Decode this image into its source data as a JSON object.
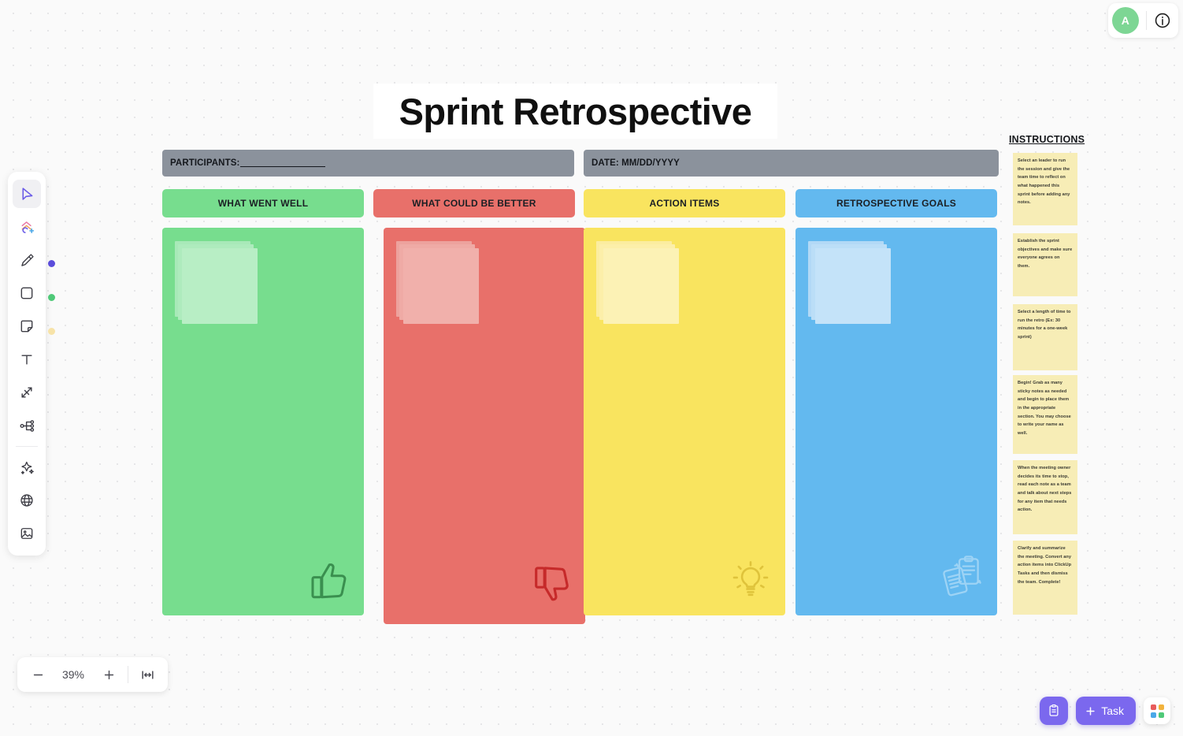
{
  "app": {
    "zoom_level": "39%",
    "avatar_initial": "A",
    "accent_color": "#7b68ee"
  },
  "toolbar": {
    "items": [
      {
        "name": "select-tool",
        "label": "Select",
        "active": true
      },
      {
        "name": "shapes-tool",
        "label": "Shapes",
        "active": false
      },
      {
        "name": "pen-tool",
        "label": "Pen",
        "active": false
      },
      {
        "name": "rectangle-tool",
        "label": "Rectangle",
        "active": false
      },
      {
        "name": "sticky-note-tool",
        "label": "Sticky Note",
        "active": false
      },
      {
        "name": "text-tool",
        "label": "Text",
        "active": false
      },
      {
        "name": "connector-tool",
        "label": "Connector",
        "active": false
      },
      {
        "name": "mindmap-tool",
        "label": "Mind Map",
        "active": false
      },
      {
        "name": "ai-tool",
        "label": "AI",
        "active": false
      },
      {
        "name": "web-tool",
        "label": "Embed",
        "active": false
      },
      {
        "name": "image-tool",
        "label": "Image",
        "active": false
      }
    ],
    "color_dots": [
      "#5b4ddb",
      "#4fc978",
      "#f7e3a8"
    ]
  },
  "zoom_controls": {
    "zoom_out_label": "−",
    "zoom_in_label": "+",
    "value": "39%",
    "fit_label": "|↔|"
  },
  "bottom_actions": {
    "doc_label": "",
    "task_label": "Task",
    "apps_label": ""
  },
  "board": {
    "title": "Sprint Retrospective",
    "participants_label": "PARTICIPANTS:",
    "date_label": "DATE: MM/DD/YYYY",
    "columns": [
      {
        "header": "WHAT WENT WELL",
        "header_color": "#77dd8e",
        "body_color": "#77dd8e",
        "note_color": "#b5eec2",
        "icon": "thumbs-up-icon",
        "icon_color": "#3a8f4f"
      },
      {
        "header": "WHAT COULD BE BETTER",
        "header_color": "#e8706a",
        "body_color": "#e8706a",
        "note_color": "#f0a5a0",
        "icon": "thumbs-down-icon",
        "icon_color": "#c62a2a"
      },
      {
        "header": "ACTION ITEMS",
        "header_color": "#f9e45f",
        "body_color": "#f9e45f",
        "note_color": "#fbf0ab",
        "icon": "lightbulb-icon",
        "icon_color": "#dfc33b"
      },
      {
        "header": "RETROSPECTIVE GOALS",
        "header_color": "#63b9ef",
        "body_color": "#63b9ef",
        "note_color": "#bddff7",
        "icon": "clipboard-checklist-icon",
        "icon_color": "#9dd3f5"
      }
    ]
  },
  "instructions": {
    "title": "INSTRUCTIONS",
    "notes": [
      "Select an leader to run the session and give the team time to reflect on what happened this sprint before adding any notes.",
      "Establish the sprint objectives and make sure everyone agrees on them.",
      "Select a length of time to run the retro (Ex: 30 minutes for a one-week sprint)",
      "Begin! Grab as many sticky notes as needed and begin to place them in the appropriate section. You may choose to write your name as well.",
      "When the meeting owner decides its time to stop, read each note as a team and talk about next steps for any item that needs action.",
      "Clarify and summarize the meeting. Convert any action items into ClickUp Tasks and then dismiss the team. Complete!"
    ]
  }
}
